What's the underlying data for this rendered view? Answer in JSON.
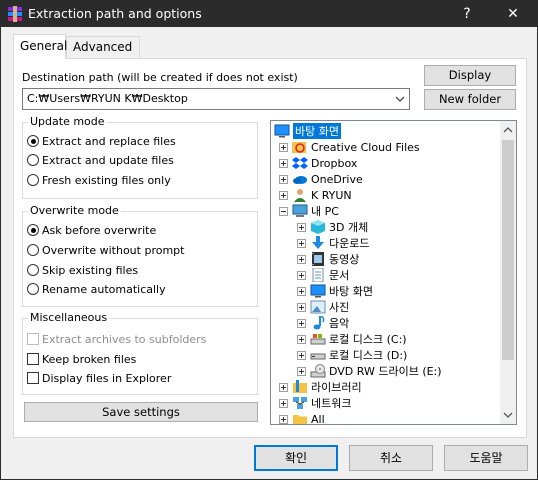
{
  "window": {
    "title": "Extraction path and options",
    "help_glyph": "?",
    "close_glyph": "✕"
  },
  "tabs": [
    {
      "label": "General",
      "active": true
    },
    {
      "label": "Advanced",
      "active": false
    }
  ],
  "destination": {
    "label": "Destination path (will be created if does not exist)",
    "value": "C:₩Users₩RYUN K₩Desktop"
  },
  "buttons": {
    "display": "Display",
    "new_folder": "New folder",
    "save_settings": "Save settings",
    "ok": "확인",
    "cancel": "취소",
    "help": "도움말"
  },
  "update_mode": {
    "title": "Update mode",
    "options": [
      {
        "label": "Extract and replace files",
        "checked": true
      },
      {
        "label": "Extract and update files",
        "checked": false
      },
      {
        "label": "Fresh existing files only",
        "checked": false
      }
    ]
  },
  "overwrite_mode": {
    "title": "Overwrite mode",
    "options": [
      {
        "label": "Ask before overwrite",
        "checked": true
      },
      {
        "label": "Overwrite without prompt",
        "checked": false
      },
      {
        "label": "Skip existing files",
        "checked": false
      },
      {
        "label": "Rename automatically",
        "checked": false
      }
    ]
  },
  "misc": {
    "title": "Miscellaneous",
    "options": [
      {
        "label": "Extract archives to subfolders",
        "checked": false,
        "disabled": true
      },
      {
        "label": "Keep broken files",
        "checked": false,
        "disabled": false
      },
      {
        "label": "Display files in Explorer",
        "checked": false,
        "disabled": false
      }
    ]
  },
  "tree": {
    "items": [
      {
        "label": "바탕 화면",
        "icon": "desktop-icon",
        "selected": true
      },
      {
        "label": "Creative Cloud Files",
        "icon": "creative-cloud-icon"
      },
      {
        "label": "Dropbox",
        "icon": "dropbox-icon"
      },
      {
        "label": "OneDrive",
        "icon": "onedrive-icon"
      },
      {
        "label": "K RYUN",
        "icon": "user-icon"
      },
      {
        "label": "내 PC",
        "icon": "pc-icon"
      },
      {
        "label": "3D 개체",
        "icon": "3d-objects-icon"
      },
      {
        "label": "다운로드",
        "icon": "downloads-icon"
      },
      {
        "label": "동영상",
        "icon": "videos-icon"
      },
      {
        "label": "문서",
        "icon": "documents-icon"
      },
      {
        "label": "바탕 화면",
        "icon": "desktop-icon"
      },
      {
        "label": "사진",
        "icon": "pictures-icon"
      },
      {
        "label": "음악",
        "icon": "music-icon"
      },
      {
        "label": "로컬 디스크 (C:)",
        "icon": "local-disk-icon"
      },
      {
        "label": "로컬 디스크 (D:)",
        "icon": "local-disk-icon"
      },
      {
        "label": "DVD RW 드라이브 (E:)",
        "icon": "dvd-drive-icon"
      },
      {
        "label": "라이브러리",
        "icon": "libraries-icon"
      },
      {
        "label": "네트워크",
        "icon": "network-icon"
      },
      {
        "label": "All",
        "icon": "folder-icon"
      }
    ]
  },
  "colors": {
    "titlebar": "#2b2b2b",
    "accent": "#0078d7",
    "window_bg": "#f0f0f0"
  }
}
